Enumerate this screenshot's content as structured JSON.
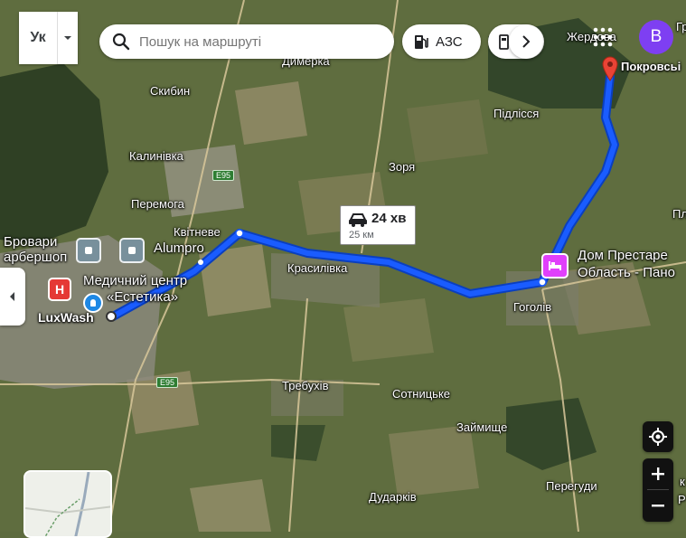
{
  "search": {
    "placeholder": "Пошук на маршруті"
  },
  "lang_toggle": {
    "label": "Ук"
  },
  "chips": [
    {
      "label": "АЗС"
    },
    {
      "label": ""
    }
  ],
  "account": {
    "initial": "B"
  },
  "route": {
    "duration": "24 хв",
    "distance": "25 км"
  },
  "destination": {
    "label": "Покровсьі"
  },
  "places": {
    "dimerka": "Димерка",
    "zherdova": "Жердова",
    "gr": "Гр",
    "skybyn": "Скибин",
    "pidlissia": "Підлісся",
    "kalynivka": "Калинівка",
    "zoria": "Зоря",
    "peremoha": "Перемога",
    "kvitneve": "Квітневе",
    "brovary": "Бровари",
    "barbershop": "арбершоп",
    "alumpro": "Alumpro",
    "med_center_1": "Медичний центр",
    "med_center_2": "«Естетика»",
    "luxwash": "LuxWash",
    "krasylivka": "Красилівка",
    "dom_1": "Дом Престаре",
    "dom_2": "Область - Пано",
    "hohoiv": "Гоголів",
    "pl": "Пл",
    "trebukhiv": "Требухів",
    "sotnytske": "Сотницьке",
    "zaimyshche": "Займище",
    "perehudy": "Перегуди",
    "dudarkiv": "Дударків",
    "k": "к",
    "r": "Р"
  },
  "highways": {
    "top": "E95",
    "bottom": "E95"
  },
  "colors": {
    "route": "#1a5cff",
    "destination_pin": "#ea4335",
    "account": "#7e3ff2",
    "hotel_poi": "#e040fb",
    "hospital_poi": "#e53935"
  },
  "icons": [
    "search-icon",
    "fuel-pump-icon",
    "chevron-right-icon",
    "apps-grid-icon",
    "car-icon",
    "my-location-icon",
    "zoom-in-icon",
    "zoom-out-icon",
    "chevron-left-icon",
    "chevron-down-icon",
    "hotel-icon",
    "hospital-icon",
    "shop-icon",
    "car-wash-icon"
  ]
}
